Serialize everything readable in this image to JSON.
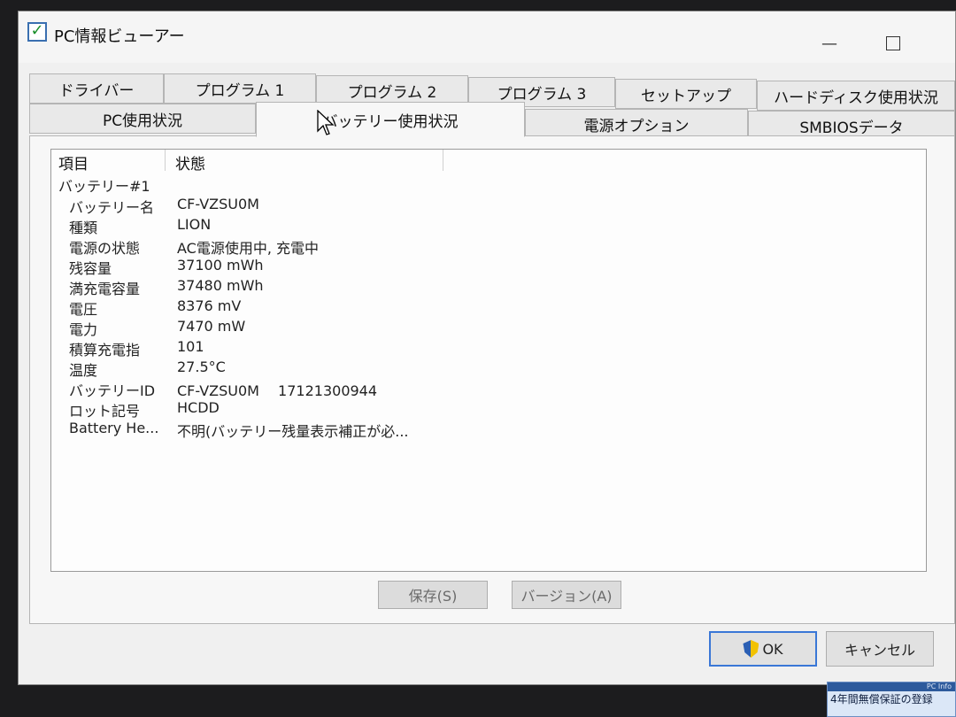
{
  "window": {
    "title": "PC情報ビューアー"
  },
  "tabs_row1": [
    {
      "label": "ドライバー"
    },
    {
      "label": "プログラム 1"
    },
    {
      "label": "プログラム 2"
    },
    {
      "label": "プログラム 3"
    },
    {
      "label": "セットアップ"
    },
    {
      "label": "ハードディスク使用状況"
    }
  ],
  "tabs_row2": [
    {
      "label": "PC使用状況"
    },
    {
      "label": "バッテリー使用状況",
      "active": true
    },
    {
      "label": "電源オプション"
    },
    {
      "label": "SMBIOSデータ"
    }
  ],
  "list": {
    "columns": [
      "項目",
      "状態"
    ],
    "group": "バッテリー#1",
    "rows": [
      {
        "key": "バッテリー名",
        "value": "CF-VZSU0M"
      },
      {
        "key": "種類",
        "value": "LION"
      },
      {
        "key": "電源の状態",
        "value": "AC電源使用中, 充電中"
      },
      {
        "key": "残容量",
        "value": "37100 mWh"
      },
      {
        "key": "満充電容量",
        "value": "37480 mWh"
      },
      {
        "key": "電圧",
        "value": "8376 mV"
      },
      {
        "key": "電力",
        "value": "7470 mW"
      },
      {
        "key": "積算充電指",
        "value": "101"
      },
      {
        "key": "温度",
        "value": "27.5°C"
      },
      {
        "key": "バッテリーID",
        "value": "CF-VZSU0M　 17121300944"
      },
      {
        "key": "ロット記号",
        "value": "HCDD"
      },
      {
        "key": "Battery He...",
        "value": "不明(バッテリー残量表示補正が必..."
      }
    ]
  },
  "buttons": {
    "save": "保存(S)",
    "version": "バージョン(A)",
    "ok": "OK",
    "cancel": "キャンセル"
  },
  "notice": {
    "header": "PC Info",
    "line1": "4年間無償保証の登録"
  }
}
